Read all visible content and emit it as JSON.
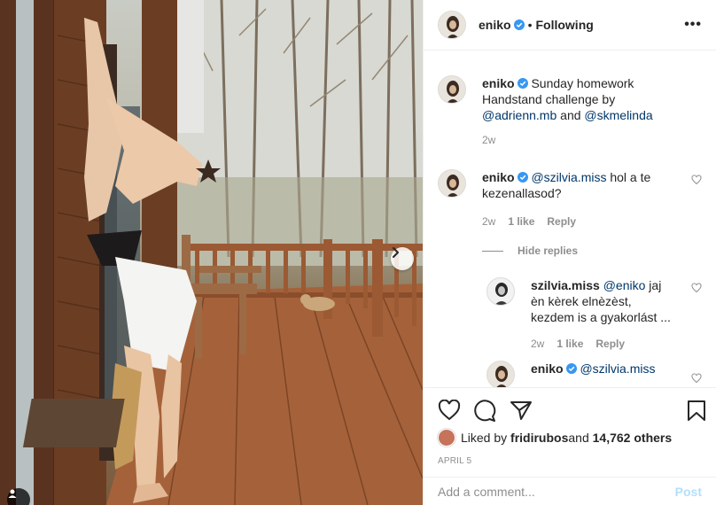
{
  "post": {
    "author": "eniko",
    "follow_status": "Following",
    "more_label": "•••",
    "next_icon": "chevron-right-icon",
    "tag_icon": "person-tag-icon"
  },
  "caption": {
    "username": "eniko",
    "text": "Sunday homework Handstand challenge by ",
    "mention1": "@adrienn.mb",
    "and": " and ",
    "mention2": "@skmelinda",
    "time": "2w"
  },
  "comments": [
    {
      "username": "eniko",
      "mention": "@szilvia.miss",
      "text": " hol a te kezenallasod?",
      "time": "2w",
      "likes": "1 like",
      "reply": "Reply"
    }
  ],
  "hide_replies": "Hide replies",
  "replies": [
    {
      "username": "szilvia.miss",
      "mention": "@eniko",
      "text": " jaj èn kèrek elnèzèst, kezdem is a gyakorlást ...",
      "time": "2w",
      "likes": "1 like",
      "reply": "Reply"
    },
    {
      "username": "eniko",
      "mention": "@szilvia.miss",
      "text": ""
    }
  ],
  "likes": {
    "prefix": "Liked by ",
    "user": "fridirubos",
    "middle": " and ",
    "count": "14,762 others"
  },
  "date": "APRIL 5",
  "add_comment": {
    "placeholder": "Add a comment...",
    "post_label": "Post"
  },
  "colors": {
    "link": "#00376b",
    "muted": "#8e8e8e",
    "verified": "#3897f0",
    "post_disabled": "#b2dffc"
  }
}
